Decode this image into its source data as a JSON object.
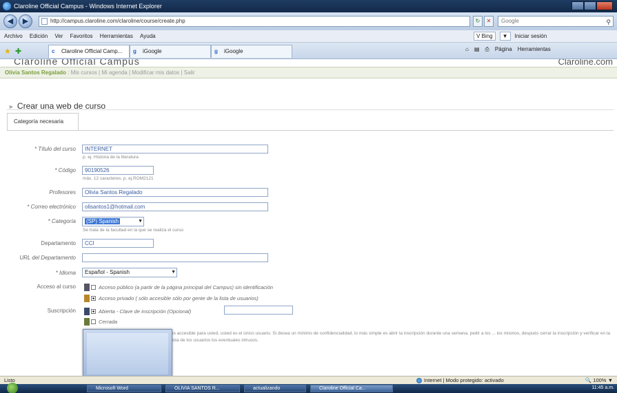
{
  "window": {
    "title": "Claroline Official Campus - Windows Internet Explorer"
  },
  "address": {
    "url": "http://campus.claroline.com/claroline/course/create.php",
    "search_placeholder": "Google"
  },
  "menu": {
    "items": [
      "Archivo",
      "Edición",
      "Ver",
      "Favoritos",
      "Herramientas",
      "Ayuda"
    ],
    "bing": "V Bing",
    "login": "Iniciar sesión"
  },
  "tabs": [
    {
      "label": "Claroline Official Camp..."
    },
    {
      "label": "iGoogle"
    },
    {
      "label": "iGoogle"
    }
  ],
  "commands": {
    "page": "Página",
    "tools": "Herramientas"
  },
  "site": {
    "title": "Claroline Official Campus",
    "domain": "Claroline.com"
  },
  "userbar": {
    "user": "Olivia Santos Regalado",
    "links": "Mis cursos | Mi agenda | Modificar mis datos | Salir"
  },
  "page": {
    "heading": "Crear una web de curso",
    "category_required": "Categoría necesaria"
  },
  "form": {
    "title_label": "* Título del curso",
    "title_value": "INTERNET",
    "title_hint": "p. ej. Historia de la literatura",
    "code_label": "* Código",
    "code_value": "90190526",
    "code_hint": "máx. 12 caracteres, p. ej.ROM2121",
    "teachers_label": "Profesores",
    "teachers_value": "Olivia Santos Regalado",
    "email_label": "* Correo electrónico",
    "email_value": "olisantos1@hotmail.com",
    "category_label": "* Categoría",
    "category_value": "(SP) Spanish",
    "category_hint": "Se trata de la facultad en la que se realiza el curso",
    "department_label": "Departamento",
    "department_value": "CCI",
    "dept_url_label": "URL del Departamento",
    "dept_url_value": "",
    "language_label": "* Idioma",
    "language_value": "Español - Spanish",
    "access_label": "Acceso al curso",
    "access_public": "Acceso público (a partir de la página principal del Campus) sin identificación",
    "access_private": "Acceso privado ( sólo accesible sólo por gente de la lista de usuarios)",
    "subscription_label": "Suscripción",
    "subscription_open": "Abierta  - Clave de inscripción (Opcional)",
    "subscription_closed": "Cerrada",
    "long_note": "es accesible para usted, usted es el único usuario. Si desea un mínimo de confidencialidad, lo más simple es abrir la inscripción durante una semana, pedir a los ... ios mismos, después cerrar la inscripción y verificar en la lista de los usuarios los eventuales intrusos."
  },
  "status": {
    "left": "Listo",
    "zone": "Internet | Modo protegido: activado",
    "zoom": "100%"
  },
  "taskbar": {
    "tasks": [
      "Microsoft Word",
      "OLIVIA SANTOS R...",
      "actualizando",
      "Claroline Official Ca..."
    ],
    "clock": "11:45 a.m."
  }
}
